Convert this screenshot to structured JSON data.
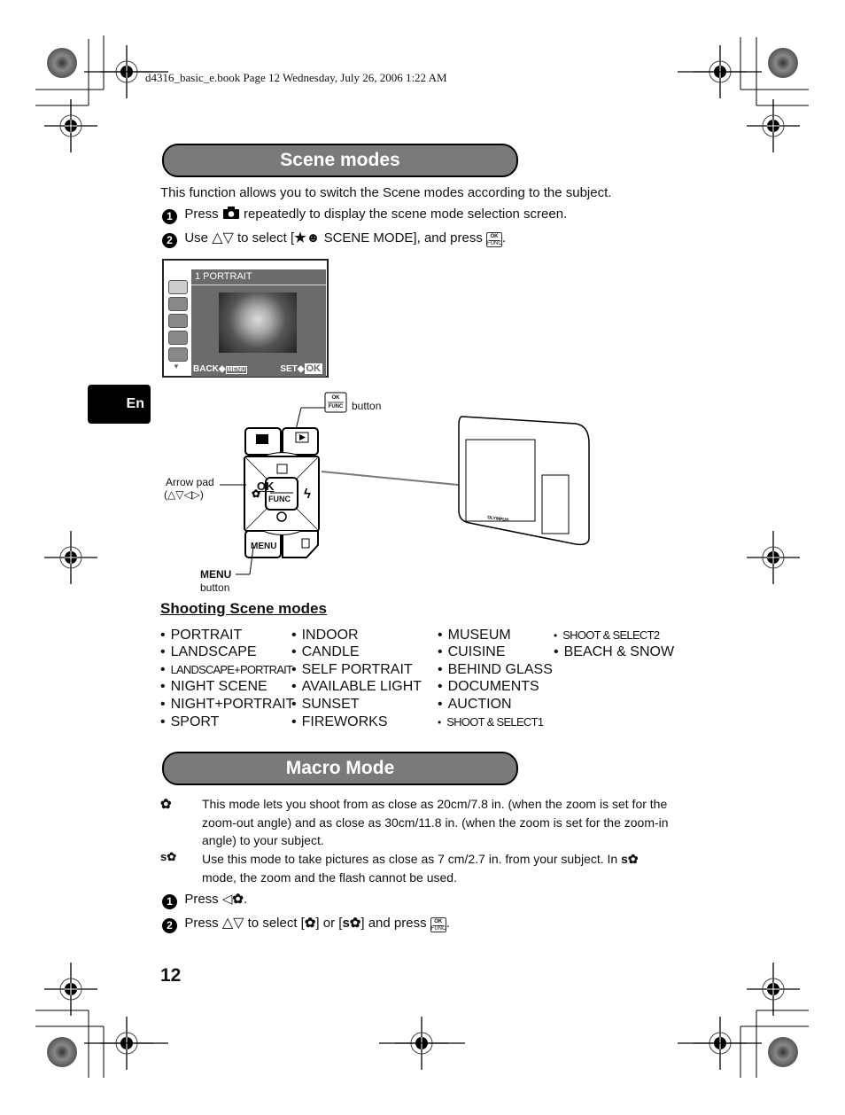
{
  "header_meta": "d4316_basic_e.book  Page 12  Wednesday, July 26, 2006  1:22 AM",
  "language_tab": "En",
  "page_number": "12",
  "scene_section": {
    "title": "Scene modes",
    "intro": "This function allows you to switch the Scene modes according to the subject.",
    "steps": [
      {
        "num": "1",
        "before": "Press",
        "icon": "camera-icon",
        "after": "repeatedly to display the scene mode selection screen."
      },
      {
        "num": "2",
        "before": "Use",
        "arrows": "△▽",
        "middle": "to select [",
        "scene_icon": "scene-mode-icon",
        "label": " SCENE MODE], and press",
        "end": "."
      }
    ]
  },
  "lcd": {
    "title": "1    PORTRAIT",
    "back_label": "BACK",
    "menu_label": "MENU",
    "set_label": "SET",
    "ok_label": "OK",
    "icons": [
      "portrait-icon",
      "landscape-icon",
      "landscape-portrait-icon",
      "night-scene-icon",
      "night-portrait-icon"
    ]
  },
  "diagram": {
    "ok_button_caption": "button",
    "ok_top": "OK",
    "ok_bottom": "FUNC",
    "arrow_pad_caption": "Arrow pad",
    "arrow_pad_glyphs": "(△▽◁▷)",
    "menu_caption_bold": "MENU",
    "menu_caption": "button",
    "menu_key": "MENU",
    "camera_brand": "OLYMPUS"
  },
  "shooting_modes": {
    "heading": "Shooting Scene modes",
    "columns": [
      [
        "PORTRAIT",
        "LANDSCAPE",
        "LANDSCAPE+PORTRAIT",
        "NIGHT SCENE",
        "NIGHT+PORTRAIT",
        "SPORT"
      ],
      [
        "INDOOR",
        "CANDLE",
        "SELF PORTRAIT",
        "AVAILABLE LIGHT",
        "SUNSET",
        "FIREWORKS"
      ],
      [
        "MUSEUM",
        "CUISINE",
        "BEHIND GLASS",
        "DOCUMENTS",
        "AUCTION",
        "SHOOT & SELECT1"
      ],
      [
        "SHOOT & SELECT2",
        "BEACH & SNOW"
      ]
    ]
  },
  "macro_section": {
    "title": "Macro Mode",
    "macro_desc": "This mode lets you shoot from as close as 20cm/7.8 in. (when the zoom is set for the zoom-out angle) and as close as 30cm/11.8 in. (when the zoom is set for the zoom-in angle) to your subject.",
    "super_macro_desc_a": "Use this mode to take pictures as close as 7 cm/2.7 in. from your subject. In",
    "super_macro_desc_b": "mode, the zoom and the flash cannot be used.",
    "step1_before": "Press",
    "step1_glyph": "◁",
    "step2_before": "Press",
    "step2_arrows": "△▽",
    "step2_mid": "to select [",
    "step2_or": "] or [",
    "step2_after": "] and press",
    "step_end": "."
  }
}
